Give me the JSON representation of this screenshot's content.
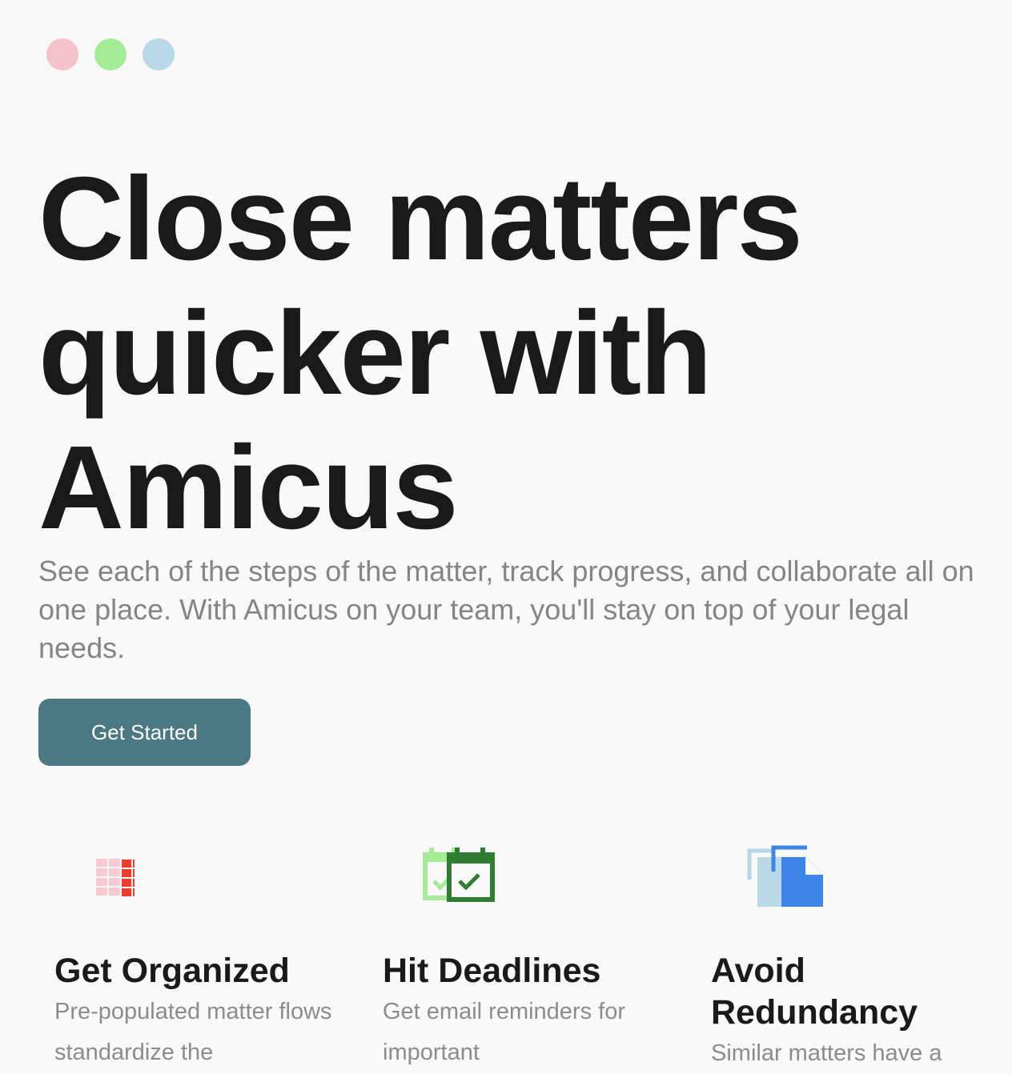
{
  "window": {
    "controls": [
      {
        "name": "close",
        "color": "#f5c1cb"
      },
      {
        "name": "minimize",
        "color": "#a4ec96"
      },
      {
        "name": "maximize",
        "color": "#b8d8e8"
      }
    ]
  },
  "hero": {
    "title": "Close matters quicker with Amicus",
    "subtitle": "See each of the steps of the matter, track progress, and collaborate all on one place. With Amicus on your team, you'll stay on top of your legal needs.",
    "cta_label": "Get Started",
    "cta_color": "#4a7883"
  },
  "features": [
    {
      "icon": "grid-list-icon",
      "icon_colors": [
        "#f8c9d1",
        "#ee3b2b"
      ],
      "title": "Get Organized",
      "description": "Pre-populated matter flows standardize the"
    },
    {
      "icon": "calendar-check-icon",
      "icon_colors": [
        "#a4ec96",
        "#2e7d32"
      ],
      "title": "Hit Deadlines",
      "description": "Get email reminders for important"
    },
    {
      "icon": "documents-copy-icon",
      "icon_colors": [
        "#b8d8e8",
        "#3d85e8"
      ],
      "title": "Avoid Redundancy",
      "description": "Similar matters have a"
    }
  ]
}
